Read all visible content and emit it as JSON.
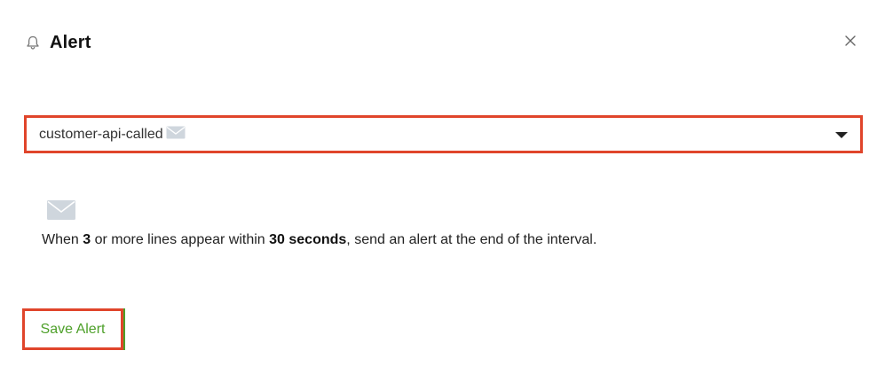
{
  "dialog": {
    "title": "Alert",
    "header_icon": "bell-icon",
    "close_icon": "close-icon"
  },
  "select": {
    "value": "customer-api-called",
    "value_icon": "mail-icon",
    "caret_icon": "caret-down-icon"
  },
  "channel": {
    "icon": "mail-icon"
  },
  "description": {
    "part1": "When ",
    "count": "3",
    "part2": " or more lines appear within ",
    "interval": "30 seconds",
    "part3": ", send an alert at the end of the interval."
  },
  "actions": {
    "save_label": "Save Alert"
  },
  "colors": {
    "highlight": "#e0452b",
    "save_text": "#4ea02a",
    "mail_icon": "#cfd6dd"
  }
}
